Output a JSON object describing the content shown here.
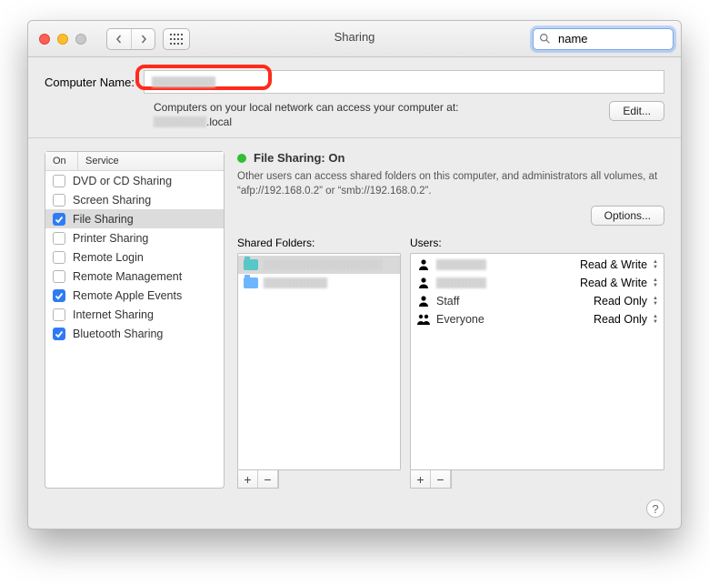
{
  "window": {
    "title": "Sharing",
    "search_value": "name"
  },
  "computer_name": {
    "label": "Computer Name:",
    "value": "",
    "info": "Computers on your local network can access your computer at:",
    "hostname_suffix": ".local",
    "edit_button": "Edit..."
  },
  "services": {
    "header_on": "On",
    "header_service": "Service",
    "items": [
      {
        "on": false,
        "label": "DVD or CD Sharing",
        "selected": false
      },
      {
        "on": false,
        "label": "Screen Sharing",
        "selected": false
      },
      {
        "on": true,
        "label": "File Sharing",
        "selected": true
      },
      {
        "on": false,
        "label": "Printer Sharing",
        "selected": false
      },
      {
        "on": false,
        "label": "Remote Login",
        "selected": false
      },
      {
        "on": false,
        "label": "Remote Management",
        "selected": false
      },
      {
        "on": true,
        "label": "Remote Apple Events",
        "selected": false
      },
      {
        "on": false,
        "label": "Internet Sharing",
        "selected": false
      },
      {
        "on": true,
        "label": "Bluetooth Sharing",
        "selected": false
      }
    ]
  },
  "detail": {
    "status_title": "File Sharing: On",
    "description": "Other users can access shared folders on this computer, and administrators all volumes, at “afp://192.168.0.2” or “smb://192.168.0.2”.",
    "options_button": "Options...",
    "shared_label": "Shared Folders:",
    "users_label": "Users:",
    "shared_folders": [
      {
        "name": "",
        "selected": true,
        "color": "teal"
      },
      {
        "name": "",
        "selected": false,
        "color": "blue"
      }
    ],
    "users": [
      {
        "name": "",
        "perm": "Read & Write",
        "icon": "user"
      },
      {
        "name": "",
        "perm": "Read & Write",
        "icon": "user"
      },
      {
        "name": "Staff",
        "perm": "Read Only",
        "icon": "user"
      },
      {
        "name": "Everyone",
        "perm": "Read Only",
        "icon": "group"
      }
    ]
  }
}
